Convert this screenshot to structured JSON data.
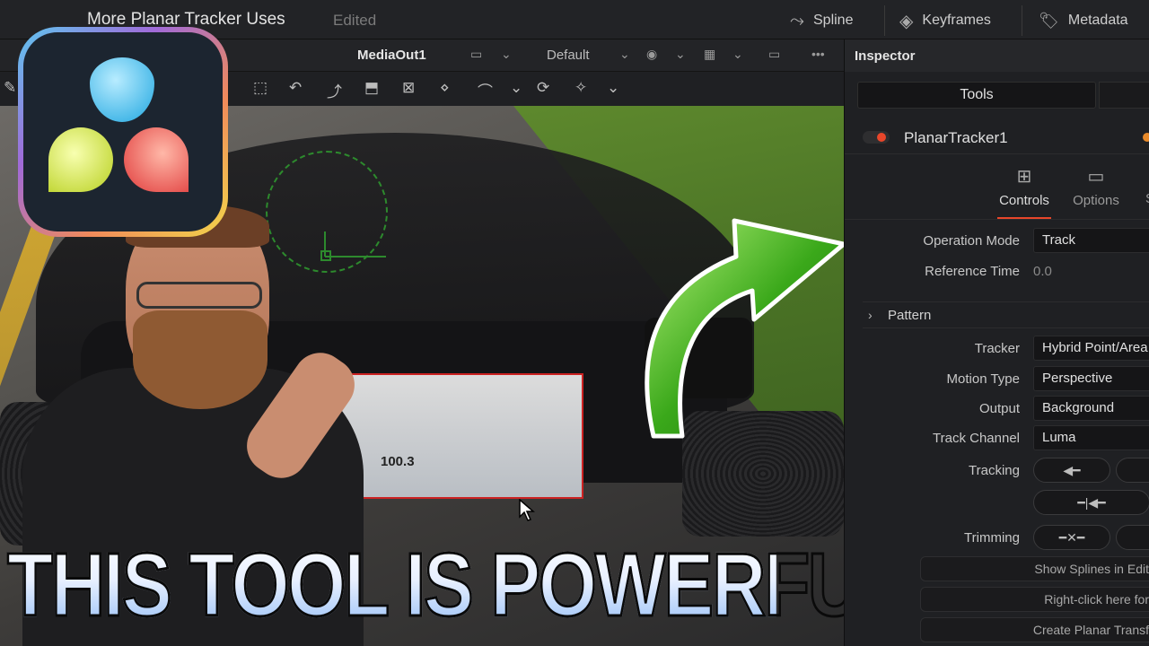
{
  "titlebar": {
    "project_title": "More Planar Tracker Uses",
    "edited_label": "Edited",
    "spline_label": "Spline",
    "keyframes_label": "Keyframes",
    "metadata_label": "Metadata"
  },
  "viewer": {
    "name": "MediaOut1",
    "default_label": "Default",
    "screen_frequency": "100.3"
  },
  "caption": "THIS TOOL IS POWERFUL!",
  "inspector": {
    "title": "Inspector",
    "tools_tab": "Tools",
    "node_name": "PlanarTracker1",
    "tabs": {
      "controls": "Controls",
      "options": "Options",
      "more": "S"
    },
    "properties": {
      "operation_mode": {
        "label": "Operation Mode",
        "value": "Track"
      },
      "reference_time": {
        "label": "Reference Time",
        "value": "0.0"
      },
      "pattern": "Pattern",
      "tracker": {
        "label": "Tracker",
        "value": "Hybrid Point/Area"
      },
      "motion_type": {
        "label": "Motion Type",
        "value": "Perspective"
      },
      "output": {
        "label": "Output",
        "value": "Background"
      },
      "track_channel": {
        "label": "Track Channel",
        "value": "Luma"
      },
      "tracking_label": "Tracking",
      "trimming_label": "Trimming"
    },
    "buttons": {
      "show_splines": "Show Splines in Edit",
      "right_click": "Right-click here for",
      "create_planar": "Create Planar Transf"
    }
  },
  "colors": {
    "accent_red": "#e8462a",
    "track_green": "#2d8a2d",
    "arrow_green": "#3aa81a"
  }
}
